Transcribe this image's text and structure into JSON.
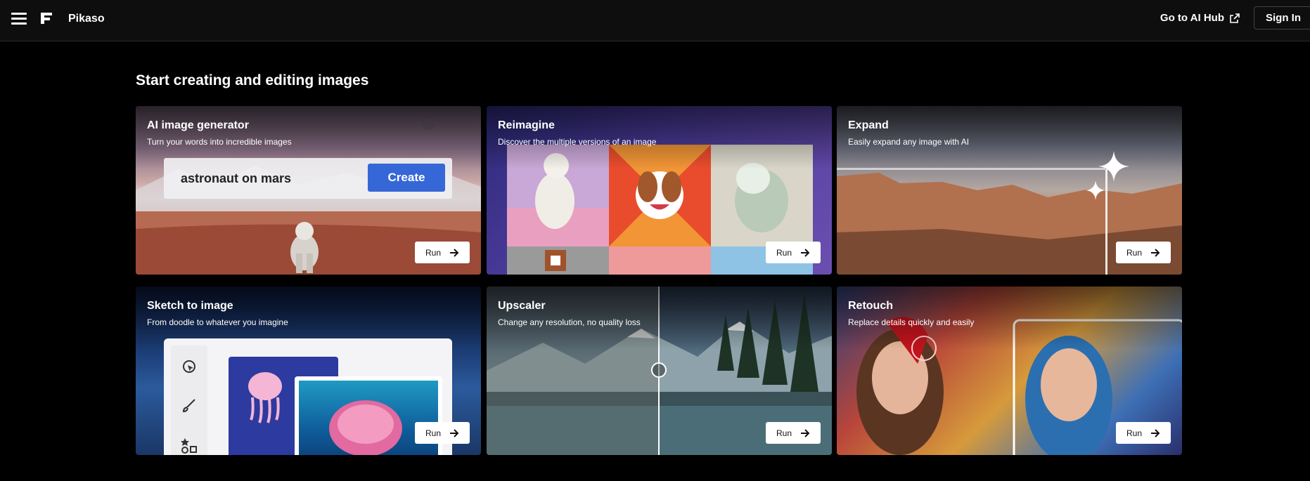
{
  "header": {
    "brand": "Pikaso",
    "hub_link": "Go to AI Hub",
    "signin": "Sign In"
  },
  "main": {
    "title": "Start creating and editing images",
    "run_label": "Run",
    "cards": [
      {
        "title": "AI image generator",
        "desc": "Turn your words into incredible images",
        "prompt": "astronaut on mars",
        "button": "Create"
      },
      {
        "title": "Reimagine",
        "desc": "Discover the multiple versions of an image"
      },
      {
        "title": "Expand",
        "desc": "Easily expand any image with AI"
      },
      {
        "title": "Sketch to image",
        "desc": "From doodle to whatever you imagine"
      },
      {
        "title": "Upscaler",
        "desc": "Change any resolution, no quality loss"
      },
      {
        "title": "Retouch",
        "desc": "Replace details quickly and easily"
      }
    ]
  },
  "icons": [
    "menu-icon",
    "logo-icon",
    "external-link-icon",
    "arrow-right-icon",
    "sparkle-icon",
    "cursor-icon",
    "brush-icon",
    "shapes-icon",
    "slider-handle-icon"
  ]
}
